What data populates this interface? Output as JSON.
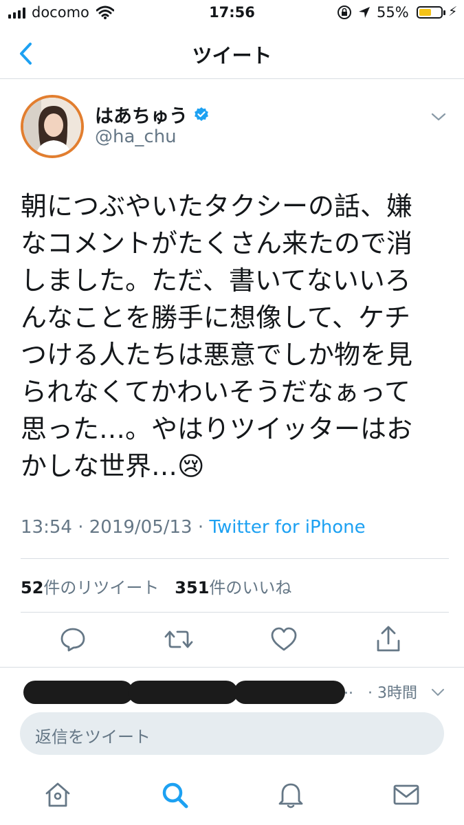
{
  "status_bar": {
    "carrier": "docomo",
    "time": "17:56",
    "battery": "55%",
    "battery_level": 0.55
  },
  "nav": {
    "title": "ツイート",
    "back_icon": "chevron-left-icon"
  },
  "tweet": {
    "display_name": "はあちゅう",
    "handle": "@ha_chu",
    "verified": true,
    "text": "朝につぶやいたタクシーの話、嫌\nなコメントがたくさん来たので消\nしました。ただ、書いてないいろ\nんなことを勝手に想像して、ケチ\nつける人たちは悪意でしか物を見\nられなくてかわいそうだなぁって\n思った…。やはりツイッターはお\nかしな世界…😢",
    "time": "13:54",
    "date": "2019/05/13",
    "separator": "·",
    "source": "Twitter for iPhone",
    "retweet_count": "52",
    "retweet_label": "件のリツイート",
    "like_count": "351",
    "like_label": "件のいいね"
  },
  "actions": [
    "reply-icon",
    "retweet-icon",
    "like-icon",
    "share-icon"
  ],
  "reply_preview": {
    "ellipsis": "..",
    "time": "· 3時間"
  },
  "reply_box": {
    "placeholder": "返信をツイート"
  },
  "tabs": [
    "home-icon",
    "search-icon",
    "notifications-icon",
    "messages-icon"
  ],
  "colors": {
    "accent": "#1da1f2",
    "secondary_text": "#657786",
    "divider": "#d8dde2",
    "reply_box_bg": "#e6ecf0",
    "battery_fill": "#f4c318"
  }
}
